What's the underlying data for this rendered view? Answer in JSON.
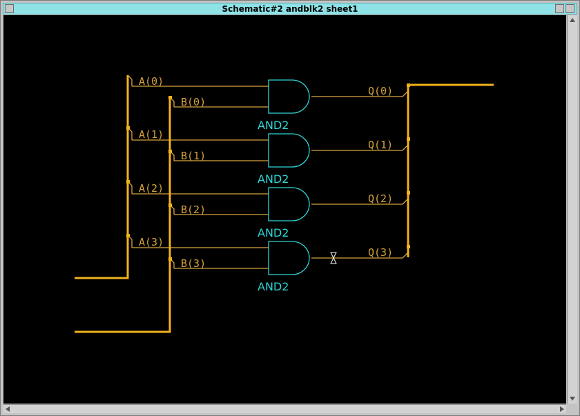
{
  "window": {
    "title": "Schematic#2 andblk2 sheet1"
  },
  "colors": {
    "bus": "#f2b21a",
    "net": "#d8a540",
    "gate": "#2fd6d6",
    "background": "#000000",
    "titlebar": "#8fe3e6"
  },
  "schematic": {
    "a_labels": [
      "A(0)",
      "A(1)",
      "A(2)",
      "A(3)"
    ],
    "b_labels": [
      "B(0)",
      "B(1)",
      "B(2)",
      "B(3)"
    ],
    "q_labels": [
      "Q(0)",
      "Q(1)",
      "Q(2)",
      "Q(3)"
    ],
    "gate_labels": [
      "AND2",
      "AND2",
      "AND2",
      "AND2"
    ]
  }
}
